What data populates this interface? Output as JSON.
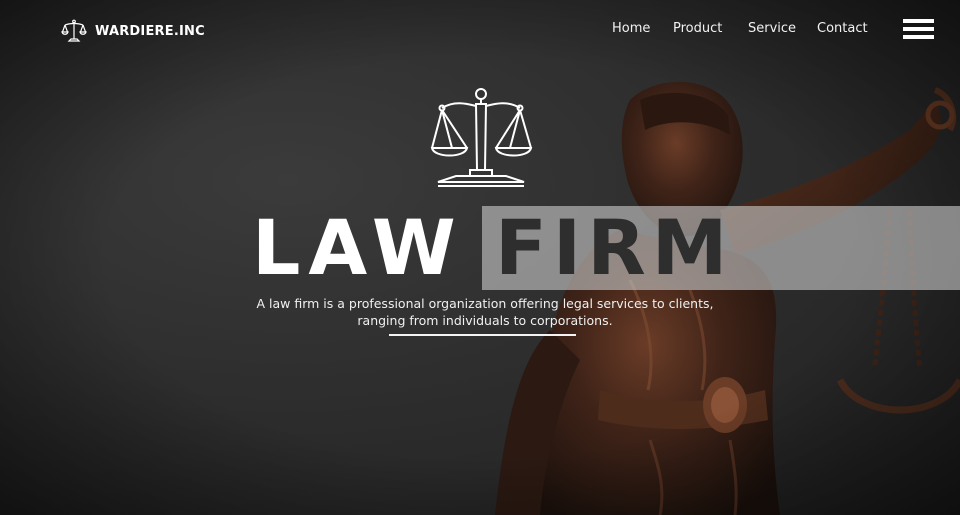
{
  "brand": {
    "name": "WARDIERE.INC",
    "logo_icon": "scales-of-justice-icon"
  },
  "nav": {
    "items": [
      {
        "label": "Home"
      },
      {
        "label": "Product"
      },
      {
        "label": "Service"
      },
      {
        "label": "Contact"
      }
    ],
    "menu_icon": "hamburger-menu-icon"
  },
  "hero": {
    "emblem_icon": "scales-of-justice-icon",
    "title_left": "LAW",
    "title_right": "FIRM",
    "description_line1": "A law firm is a professional organization offering legal services to clients,",
    "description_line2": "ranging from individuals to corporations."
  },
  "colors": {
    "background": "#2f2f2f",
    "text": "#ffffff",
    "banner": "#c8c8c8",
    "banner_text": "#2e2e2e",
    "bronze": "#4a2a1c"
  }
}
